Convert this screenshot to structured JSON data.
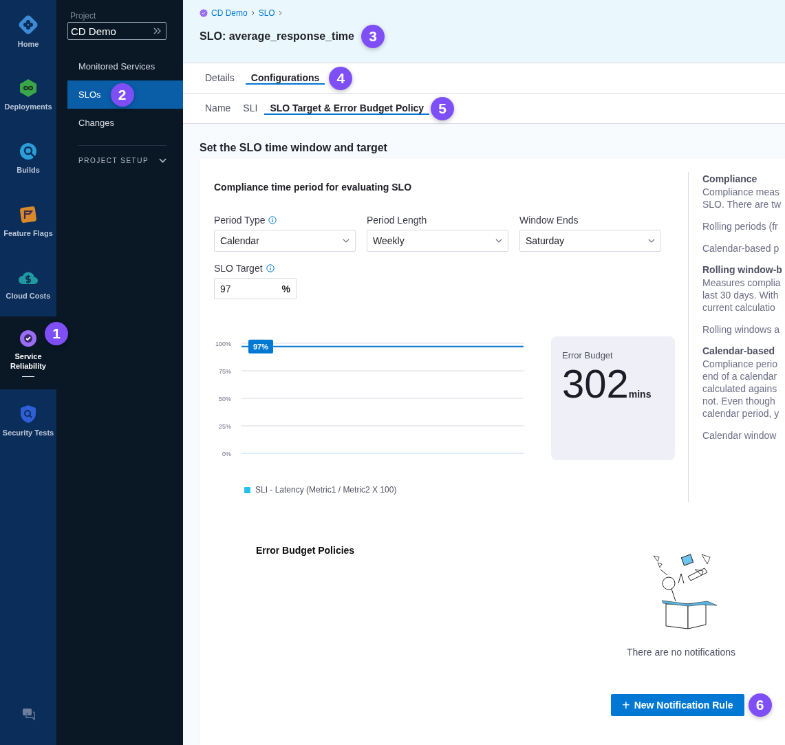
{
  "rail": {
    "items": [
      {
        "label": "Home",
        "selected": false
      },
      {
        "label": "Deployments",
        "selected": false
      },
      {
        "label": "Builds",
        "selected": false
      },
      {
        "label": "Feature Flags",
        "selected": false
      },
      {
        "label": "Cloud Costs",
        "selected": false
      },
      {
        "label": "Service Reliability",
        "selected": true,
        "callout": "1"
      },
      {
        "label": "Security Tests",
        "selected": false
      }
    ]
  },
  "sidebar": {
    "project_label": "Project",
    "project": "CD Demo",
    "items": [
      {
        "label": "Monitored Services",
        "selected": false
      },
      {
        "label": "SLOs",
        "selected": true,
        "callout": "2"
      },
      {
        "label": "Changes",
        "selected": false
      }
    ],
    "section": {
      "label": "PROJECT SETUP",
      "expanded": false
    }
  },
  "header": {
    "breadcrumbs": [
      "CD Demo",
      "SLO"
    ],
    "title": "SLO: average_response_time",
    "title_callout": "3"
  },
  "tabs": [
    {
      "label": "Details",
      "selected": false
    },
    {
      "label": "Configurations",
      "selected": true,
      "callout": "4"
    }
  ],
  "subtabs": [
    {
      "label": "Name",
      "selected": false
    },
    {
      "label": "SLI",
      "selected": false
    },
    {
      "label": "SLO Target & Error Budget Policy",
      "selected": true,
      "callout": "5"
    }
  ],
  "section_title": "Set the SLO time window and target",
  "form": {
    "title": "Compliance time period for evaluating SLO",
    "selects": [
      {
        "label": "Period Type",
        "info": true,
        "value": "Calendar"
      },
      {
        "label": "Period Length",
        "info": false,
        "value": "Weekly"
      },
      {
        "label": "Window Ends",
        "info": false,
        "value": "Saturday"
      }
    ],
    "target": {
      "label": "SLO Target",
      "info": true,
      "value": "97",
      "suffix": "%"
    }
  },
  "chart": {
    "chart_data": {
      "type": "line",
      "ylim": [
        0,
        100
      ],
      "yticks": [
        {
          "value": 100,
          "label": "100%"
        },
        {
          "value": 75,
          "label": "75%"
        },
        {
          "value": 50,
          "label": "50%"
        },
        {
          "value": 25,
          "label": "25%"
        },
        {
          "value": 0,
          "label": "0%"
        }
      ],
      "series": [
        {
          "name": "SLI - Latency (Metric1 / Metric2 X 100)",
          "color": "#25c0ef"
        }
      ],
      "grid": true,
      "ref_lines": [
        {
          "axis": "y",
          "value": 97,
          "label": "97%"
        }
      ]
    }
  },
  "error_budget": {
    "label": "Error Budget",
    "value": "302",
    "unit": "mins"
  },
  "help": {
    "sections": [
      {
        "heading": "Compliance",
        "paragraphs": [
          [
            "Compliance meas",
            "SLO. There are tw"
          ],
          [
            "Rolling periods (fr"
          ],
          [
            "Calendar-based p"
          ]
        ]
      },
      {
        "heading": "Rolling window-b",
        "paragraphs": [
          [
            "Measures complia",
            "last 30 days. With",
            "current calculatio"
          ],
          [
            "Rolling windows a"
          ]
        ]
      },
      {
        "heading": "Calendar-based",
        "paragraphs": [
          [
            "Compliance perio",
            "end of a calendar",
            "calculated agains",
            "not. Even though",
            "calendar period, y"
          ],
          [
            "Calendar window"
          ]
        ]
      }
    ]
  },
  "policies": {
    "title": "Error Budget Policies",
    "empty_text": "There are no notifications",
    "button": "New Notification Rule",
    "button_icon": "+",
    "button_callout": "6"
  }
}
